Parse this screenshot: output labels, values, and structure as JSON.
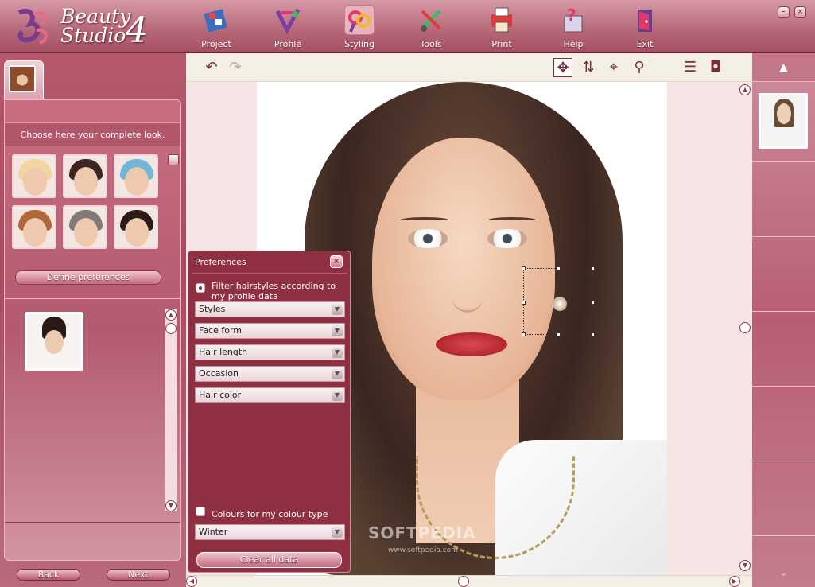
{
  "app": {
    "logo_line1": "Beauty",
    "logo_line2": "Studio",
    "logo_version": "4"
  },
  "nav": {
    "items": [
      {
        "label": "Project",
        "icon": "project-icon"
      },
      {
        "label": "Profile",
        "icon": "profile-icon"
      },
      {
        "label": "Styling",
        "icon": "styling-icon",
        "active": true
      },
      {
        "label": "Tools",
        "icon": "tools-icon"
      },
      {
        "label": "Print",
        "icon": "print-icon"
      },
      {
        "label": "Help",
        "icon": "help-icon"
      },
      {
        "label": "Exit",
        "icon": "exit-icon"
      }
    ]
  },
  "window_controls": {
    "minimize": "–",
    "close": "×"
  },
  "left": {
    "heading": "Choose here your complete look.",
    "looks": [
      {
        "name": "look-blonde-bob",
        "hair": "#f2d6a0"
      },
      {
        "name": "look-glasses",
        "hair": "#3a2520"
      },
      {
        "name": "look-hat",
        "hair": "#6fb6d8"
      },
      {
        "name": "look-red-hair",
        "hair": "#b0683a"
      },
      {
        "name": "look-veil",
        "hair": "#7f7a78"
      },
      {
        "name": "look-dark-updo",
        "hair": "#2b1b18"
      }
    ],
    "define_pref_label": "Define preferences",
    "back_label": "Back",
    "next_label": "Next"
  },
  "toolbar": {
    "undo": "↶",
    "redo": "↷",
    "move": "✥",
    "rotate": "⇅",
    "target": "⌖",
    "zoom": "⚲",
    "menu": "☰",
    "camera": "◘"
  },
  "prefs": {
    "title": "Preferences",
    "close": "×",
    "filter_label": "Filter hairstyles according to my profile data",
    "filter_checked": true,
    "dropdowns": [
      "Styles",
      "Face form",
      "Hair length",
      "Occasion",
      "Hair color"
    ],
    "colour_label": "Colours for my colour type",
    "colour_checked": false,
    "colour_value": "Winter",
    "clear_label": "Clear all data"
  },
  "watermark": {
    "line1": "SOFTPEDIA",
    "line2": "www.softpedia.com"
  },
  "right": {
    "up": "▲",
    "down": "⌄"
  },
  "colors": {
    "accent": "#8f2f42",
    "topbar": "#b86a7a",
    "panel": "#b7596d"
  }
}
